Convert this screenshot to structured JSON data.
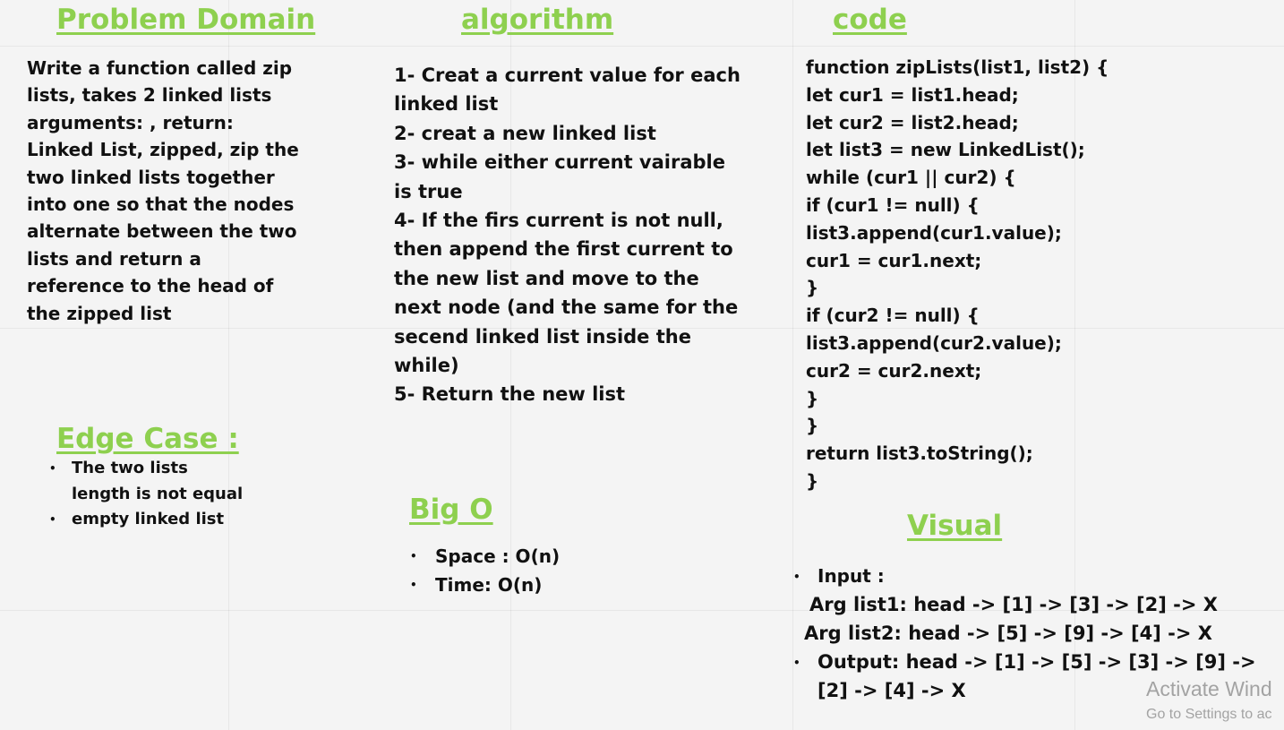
{
  "sections": {
    "problem_domain": {
      "heading": "Problem Domain",
      "lines": [
        "Write a function called zip",
        "lists, takes 2 linked lists",
        "arguments:  , return:",
        "Linked List, zipped, zip the",
        "two linked lists together",
        "into one so that the nodes",
        "alternate between the two",
        "lists and return a",
        "reference to the head of",
        "the zipped list"
      ]
    },
    "algorithm": {
      "heading": "algorithm",
      "lines": [
        "1- Creat a current value for each",
        "linked list",
        "2- creat a new linked list",
        "3- while either current vairable",
        "is true",
        "4- If the firs current is not null,",
        "then append the first current to",
        "the new list and move to the",
        "next node (and the same for the",
        "secend linked list inside the",
        "while)",
        "5- Return the new list"
      ]
    },
    "code": {
      "heading": "code",
      "lines": [
        "function zipLists(list1, list2) {",
        "  let cur1 = list1.head;",
        "  let cur2 = list2.head;",
        "  let list3 = new LinkedList();",
        "  while (cur1 || cur2) {",
        "    if (cur1 != null) {",
        "      list3.append(cur1.value);",
        "      cur1 = cur1.next;",
        "    }",
        "    if (cur2 != null) {",
        "      list3.append(cur2.value);",
        "      cur2 = cur2.next;",
        "    }",
        "  }",
        "  return list3.toString();",
        "}"
      ]
    },
    "edge_case": {
      "heading": "Edge Case :",
      "items": [
        [
          "The two lists",
          "length is not equal"
        ],
        [
          "empty linked list"
        ]
      ]
    },
    "big_o": {
      "heading": "Big O",
      "items": [
        "Space : O(n)",
        "Time: O(n)"
      ]
    },
    "visual": {
      "heading": "Visual",
      "input_label": "Input :",
      "arg1": "Arg list1: head -> [1] -> [3] -> [2] -> X",
      "arg2": "Arg list2: head -> [5] -> [9] -> [4] -> X",
      "output_lines": [
        "Output: head -> [1] -> [5] -> [3] -> [9] ->",
        "[2] -> [4] -> X"
      ]
    }
  },
  "watermark": {
    "title": "Activate Wind",
    "subtitle": "Go to Settings to ac"
  },
  "colors": {
    "heading": "#8ed04f",
    "text": "#111111",
    "background": "#f4f4f4",
    "watermark": "#a3a3a3"
  }
}
